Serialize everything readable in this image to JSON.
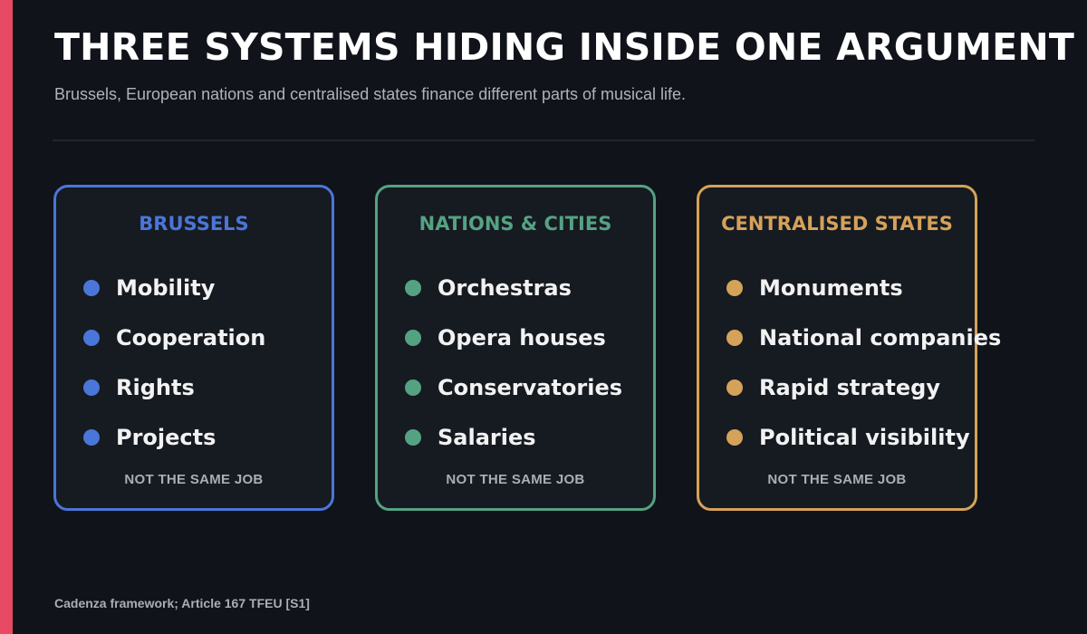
{
  "title": "THREE SYSTEMS HIDING INSIDE ONE ARGUMENT",
  "subtitle": "Brussels, European nations and centralised states finance different parts of musical life.",
  "colors": {
    "accent": "#e94a63",
    "background": "#10131a",
    "brussels": "#4a76d9",
    "nations": "#55a282",
    "centralised": "#d5a25a"
  },
  "cards": [
    {
      "title": "BRUSSELS",
      "items": [
        "Mobility",
        "Cooperation",
        "Rights",
        "Projects"
      ],
      "footer": "NOT THE SAME JOB"
    },
    {
      "title": "NATIONS & CITIES",
      "items": [
        "Orchestras",
        "Opera houses",
        "Conservatories",
        "Salaries"
      ],
      "footer": "NOT THE SAME JOB"
    },
    {
      "title": "CENTRALISED STATES",
      "items": [
        "Monuments",
        "National companies",
        "Rapid strategy",
        "Political visibility"
      ],
      "footer": "NOT THE SAME JOB"
    }
  ],
  "source": "Cadenza framework; Article 167 TFEU [S1]"
}
